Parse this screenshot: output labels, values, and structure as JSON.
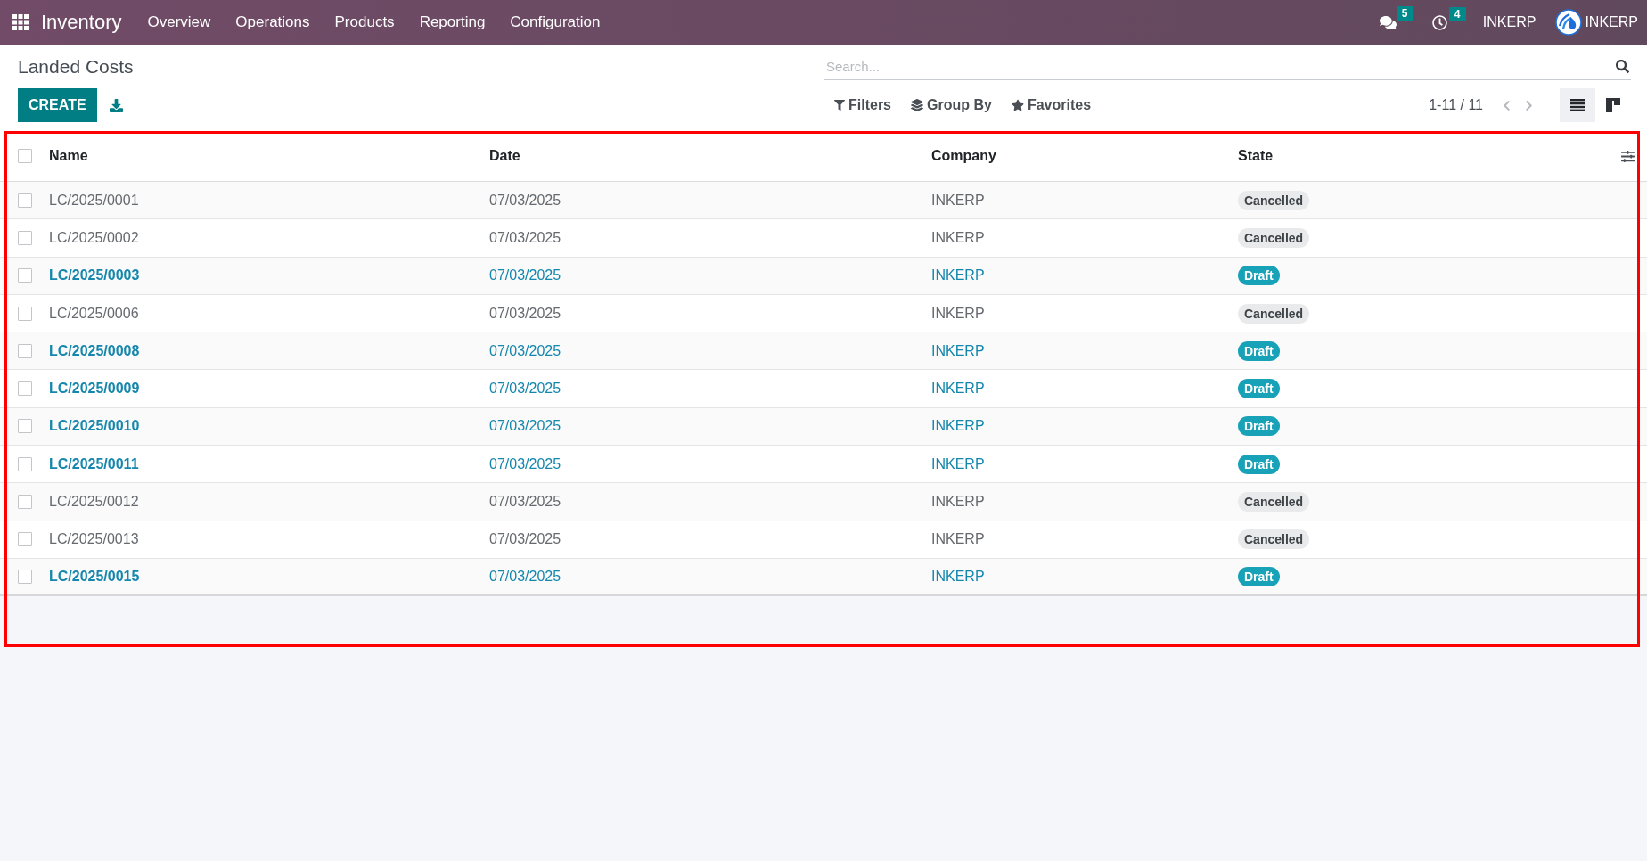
{
  "navbar": {
    "app_name": "Inventory",
    "menu": [
      "Overview",
      "Operations",
      "Products",
      "Reporting",
      "Configuration"
    ],
    "systray": [
      {
        "kind": "messages",
        "count": "5"
      },
      {
        "kind": "activities",
        "count": "4"
      }
    ],
    "company": "INKERP",
    "user": "INKERP"
  },
  "control_panel": {
    "title": "Landed Costs",
    "create_button": "CREATE",
    "search": {
      "placeholder": "Search..."
    },
    "search_options": [
      {
        "kind": "filters",
        "label": "Filters"
      },
      {
        "kind": "group_by",
        "label": "Group By"
      },
      {
        "kind": "favorites",
        "label": "Favorites"
      }
    ],
    "pager": "1-11 / 11",
    "views": [
      {
        "kind": "list",
        "selected": true
      },
      {
        "kind": "kanban",
        "selected": false
      }
    ]
  },
  "table": {
    "highlighted": true,
    "all_checked": false,
    "columns": [
      "Name",
      "Date",
      "Company",
      "State"
    ],
    "rows": [
      {
        "name": "LC/2025/0001",
        "date": "07/03/2025",
        "company": "INKERP",
        "state": "Cancelled",
        "kind": "cancelled",
        "checked": false
      },
      {
        "name": "LC/2025/0002",
        "date": "07/03/2025",
        "company": "INKERP",
        "state": "Cancelled",
        "kind": "cancelled",
        "checked": false
      },
      {
        "name": "LC/2025/0003",
        "date": "07/03/2025",
        "company": "INKERP",
        "state": "Draft",
        "kind": "draft",
        "checked": false
      },
      {
        "name": "LC/2025/0006",
        "date": "07/03/2025",
        "company": "INKERP",
        "state": "Cancelled",
        "kind": "cancelled",
        "checked": false
      },
      {
        "name": "LC/2025/0008",
        "date": "07/03/2025",
        "company": "INKERP",
        "state": "Draft",
        "kind": "draft",
        "checked": false
      },
      {
        "name": "LC/2025/0009",
        "date": "07/03/2025",
        "company": "INKERP",
        "state": "Draft",
        "kind": "draft",
        "checked": false
      },
      {
        "name": "LC/2025/0010",
        "date": "07/03/2025",
        "company": "INKERP",
        "state": "Draft",
        "kind": "draft",
        "checked": false
      },
      {
        "name": "LC/2025/0011",
        "date": "07/03/2025",
        "company": "INKERP",
        "state": "Draft",
        "kind": "draft",
        "checked": false
      },
      {
        "name": "LC/2025/0012",
        "date": "07/03/2025",
        "company": "INKERP",
        "state": "Cancelled",
        "kind": "cancelled",
        "checked": false
      },
      {
        "name": "LC/2025/0013",
        "date": "07/03/2025",
        "company": "INKERP",
        "state": "Cancelled",
        "kind": "cancelled",
        "checked": false
      },
      {
        "name": "LC/2025/0015",
        "date": "07/03/2025",
        "company": "INKERP",
        "state": "Draft",
        "kind": "draft",
        "checked": false
      }
    ]
  }
}
